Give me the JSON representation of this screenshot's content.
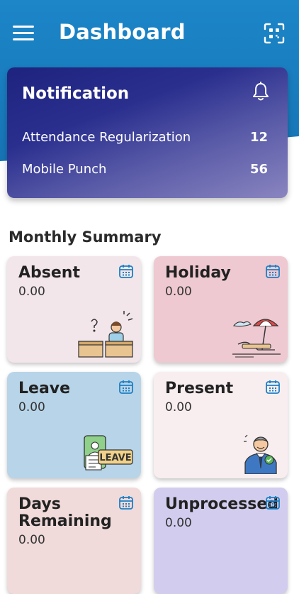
{
  "header": {
    "title": "Dashboard"
  },
  "notification": {
    "title": "Notification",
    "items": [
      {
        "label": "Attendance Regularization",
        "count": "12"
      },
      {
        "label": "Mobile Punch",
        "count": "56"
      }
    ]
  },
  "summary": {
    "title": "Monthly Summary",
    "tiles": [
      {
        "label": "Absent",
        "value": "0.00",
        "color": "#f2e6ea"
      },
      {
        "label": "Holiday",
        "value": "0.00",
        "color": "#efc9d1"
      },
      {
        "label": "Leave",
        "value": "0.00",
        "color": "#b8d4e8"
      },
      {
        "label": "Present",
        "value": "0.00",
        "color": "#f8eef0"
      },
      {
        "label": "Days",
        "label2": "Remaining",
        "value": "0.00",
        "color": "#f0dada"
      },
      {
        "label": "Unprocessed",
        "value": "0.00",
        "color": "#d2cdee"
      }
    ]
  },
  "icons": {
    "menu": "menu-icon",
    "qr": "qr-scan-icon",
    "bell": "bell-icon",
    "calendar": "calendar-icon"
  },
  "colors": {
    "header": "#1c86c8",
    "notification_dark": "#1e237f",
    "calendar_icon": "#1c7fc4"
  }
}
